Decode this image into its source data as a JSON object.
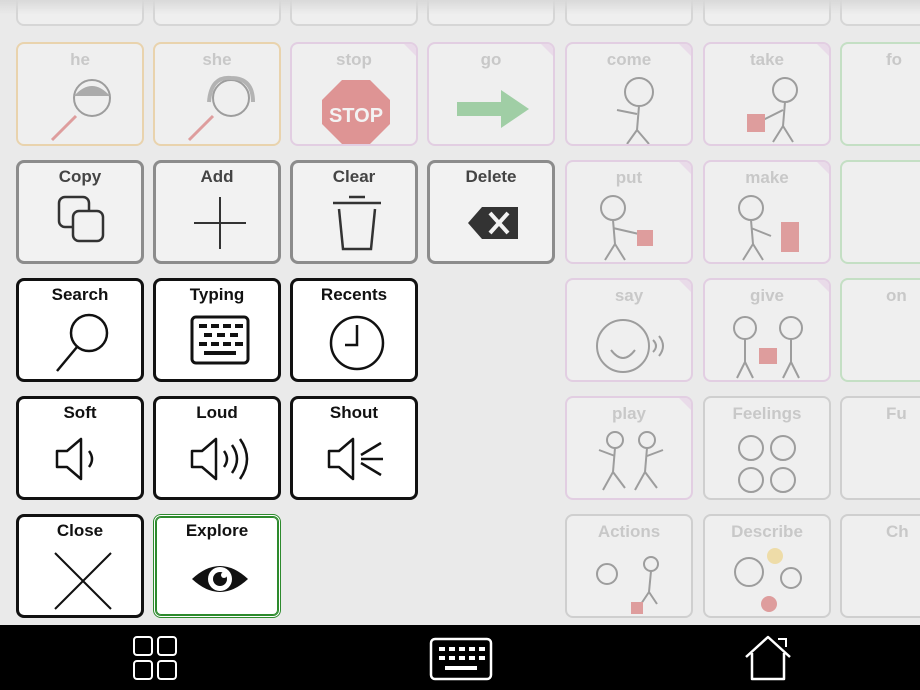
{
  "background_grid": {
    "row1": [
      "he",
      "she",
      "stop",
      "go",
      "come",
      "take",
      "fo"
    ],
    "row2": [
      "put",
      "make",
      ""
    ],
    "row3": [
      "say",
      "give",
      "on"
    ],
    "row4": [
      "play",
      "Feelings",
      "Fu"
    ],
    "row5": [
      "Actions",
      "Describe",
      "Ch"
    ],
    "stop_sign_text": "STOP"
  },
  "menu": {
    "copy": "Copy",
    "add": "Add",
    "clear": "Clear",
    "delete": "Delete",
    "search": "Search",
    "typing": "Typing",
    "recents": "Recents",
    "soft": "Soft",
    "loud": "Loud",
    "shout": "Shout",
    "close": "Close",
    "explore": "Explore"
  },
  "bottom_bar": {
    "icons": [
      "grid-icon",
      "keyboard-icon",
      "home-icon"
    ]
  },
  "colors": {
    "active_border": "#2d8a2d",
    "bottom_bar": "#000000"
  }
}
